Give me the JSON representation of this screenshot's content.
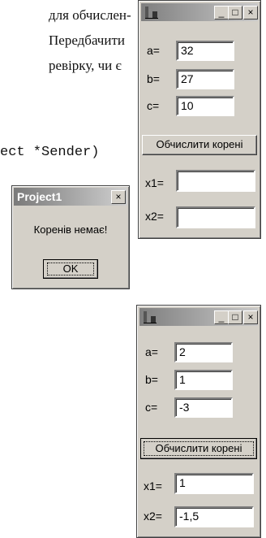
{
  "doc": {
    "line1": "для обчислен-",
    "line2": "Передбачити",
    "line3": "ревірку, чи є",
    "code_line": "ect *Sender)"
  },
  "window1": {
    "labels": {
      "a": "a=",
      "b": "b=",
      "c": "c=",
      "x1": "x1=",
      "x2": "x2="
    },
    "values": {
      "a": "32",
      "b": "27",
      "c": "10",
      "x1": "",
      "x2": ""
    },
    "button": "Обчислити корені",
    "caption_buttons": {
      "minimize": "_",
      "maximize": "□",
      "close": "×"
    }
  },
  "messagebox": {
    "title": "Project1",
    "close": "×",
    "message": "Коренів немає!",
    "ok": "OK"
  },
  "window2": {
    "labels": {
      "a": "a=",
      "b": "b=",
      "c": "c=",
      "x1": "x1=",
      "x2": "x2="
    },
    "values": {
      "a": "2",
      "b": "1",
      "c": "-3",
      "x1": "1",
      "x2": "-1,5"
    },
    "button": "Обчислити корені",
    "caption_buttons": {
      "minimize": "_",
      "maximize": "□",
      "close": "×"
    }
  }
}
